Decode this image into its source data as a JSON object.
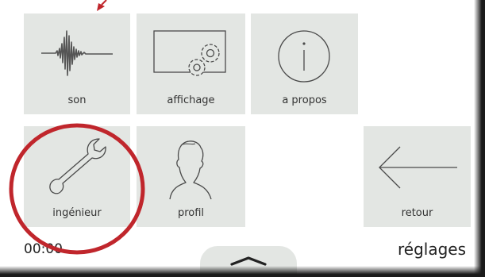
{
  "tiles": {
    "son": {
      "label": "son",
      "icon": "waveform-icon"
    },
    "affichage": {
      "label": "affichage",
      "icon": "display-settings-icon"
    },
    "apropos": {
      "label": "a propos",
      "icon": "info-icon"
    },
    "ingenieur": {
      "label": "ingénieur",
      "icon": "wrench-icon"
    },
    "profil": {
      "label": "profil",
      "icon": "user-silhouette-icon"
    },
    "retour": {
      "label": "retour",
      "icon": "arrow-left-icon"
    }
  },
  "status": {
    "clock": "00:00",
    "page_title": "réglages"
  },
  "drawer": {
    "icon": "chevron-up-icon"
  },
  "annotations": {
    "circle_icon": "highlight-circle-icon",
    "arrow_icon": "pointer-arrow-icon"
  },
  "colors": {
    "tile": "#e3e6e3",
    "icon_stroke": "#4a4a4a",
    "annotation": "#c0262c"
  }
}
